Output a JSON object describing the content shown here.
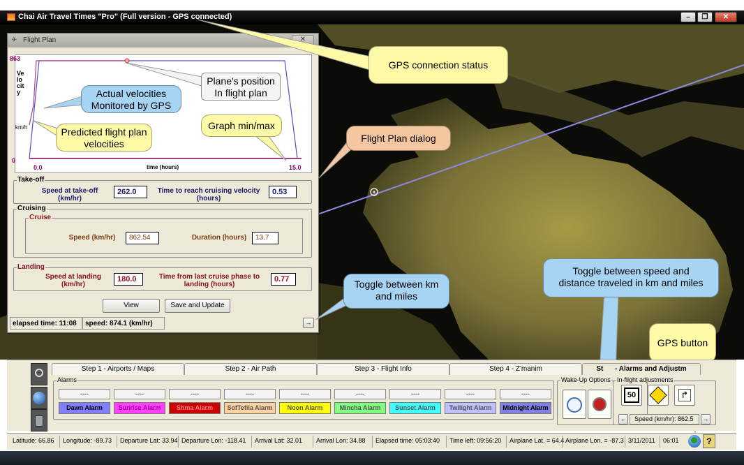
{
  "window": {
    "title": "Chai Air Travel Times \"Pro\"   (Full version - GPS connected)",
    "minimize": "–",
    "maximize": "❐",
    "close": "✕"
  },
  "flight_plan": {
    "title": "Flight Plan",
    "close": "✕",
    "graph": {
      "y_max_label": "863",
      "y_min_label": "0",
      "x_min_label": "0.0",
      "x_max_label": "15.0",
      "ylabel": "Velocity",
      "yunit": "km/h",
      "xlabel": "time (hours)"
    },
    "takeoff": {
      "legend": "Take-off",
      "speed_label": "Speed at take-off\n(km/hr)",
      "speed_value": "262.0",
      "time_label": "Time to reach cruising velocity\n(hours)",
      "time_value": "0.53"
    },
    "cruising": {
      "legend": "Cruising",
      "inner_legend": "Cruise",
      "speed_label": "Speed (km/hr)",
      "speed_value": "862.54",
      "duration_label": "Duration (hours)",
      "duration_value": "13.7"
    },
    "landing": {
      "legend": "Landing",
      "speed_label": "Speed at landing\n(km/hr)",
      "speed_value": "180.0",
      "time_label": "Time from last cruise phase to\nlanding (hours)",
      "time_value": "0.77"
    },
    "view_button": "View",
    "save_button": "Save and Update",
    "elapsed": "elapsed time: 11:08",
    "speed": "speed: 874.1 (km/hr)",
    "toggle_arrow": "→"
  },
  "callouts": {
    "gps_status": "GPS connection status",
    "plane_position": "Plane's position\nIn flight plan",
    "actual_velocities": "Actual velocities\nMonitored by GPS",
    "predicted_velocities": "Predicted flight plan\nvelocities",
    "graph_minmax": "Graph min/max",
    "flight_plan_dialog": "Flight Plan dialog",
    "toggle_km_miles": "Toggle between km\nand miles",
    "toggle_speed_distance": "Toggle between speed and\ndistance traveled in km and miles",
    "gps_button": "GPS button"
  },
  "tabs": [
    {
      "label": "Step 1 - Airports / Maps"
    },
    {
      "label": "Step 2 - Air Path"
    },
    {
      "label": "Step 3 - Flight Info"
    },
    {
      "label": "Step 4 - Z'manim"
    },
    {
      "label": "St      - Alarms and Adjustm"
    }
  ],
  "alarms": {
    "legend": "Alarms",
    "items": [
      {
        "value": "----",
        "label": "Dawn Alarm",
        "color": "#8080ff"
      },
      {
        "value": "----",
        "label": "Sunrise Alarm",
        "color": "#ff40ff"
      },
      {
        "value": "----",
        "label": "Shma Alarm",
        "color": "#c80000"
      },
      {
        "value": "----",
        "label": "SofTefila Alarm",
        "color": "#ffd0a0"
      },
      {
        "value": "----",
        "label": "Noon Alarm",
        "color": "#ffff00"
      },
      {
        "value": "----",
        "label": "Mincha Alarm",
        "color": "#80ff80"
      },
      {
        "value": "----",
        "label": "Sunset Alarm",
        "color": "#40ffff"
      },
      {
        "value": "----",
        "label": "Twilight Alarm",
        "color": "#c0c0ff"
      },
      {
        "value": "----",
        "label": "Midnight Alarm",
        "color": "#8080e0"
      }
    ]
  },
  "wakeup": {
    "legend": "Wake-Up Options",
    "inflight_legend": "In-flight adjustments",
    "speed_display": "Speed (km/hr): 862.5",
    "left_arrow": "←",
    "right_arrow": "→"
  },
  "statusbar": [
    {
      "text": "Latitude: 66.86"
    },
    {
      "text": "Longitude: -89.73"
    },
    {
      "text": "Departure Lat: 33.94"
    },
    {
      "text": "Departure Lon: -118.41"
    },
    {
      "text": "Arrival Lat: 32.01"
    },
    {
      "text": "Arrival Lon: 34.88"
    },
    {
      "text": "Elapsed time: 05:03:40"
    },
    {
      "text": "Time left: 09:56:20"
    },
    {
      "text": "Airplane Lat. = 64.4"
    },
    {
      "text": "Airplane Lon. = -87.3"
    },
    {
      "text": "3/11/2011"
    },
    {
      "text": "06:01"
    }
  ],
  "help_icon": "?"
}
